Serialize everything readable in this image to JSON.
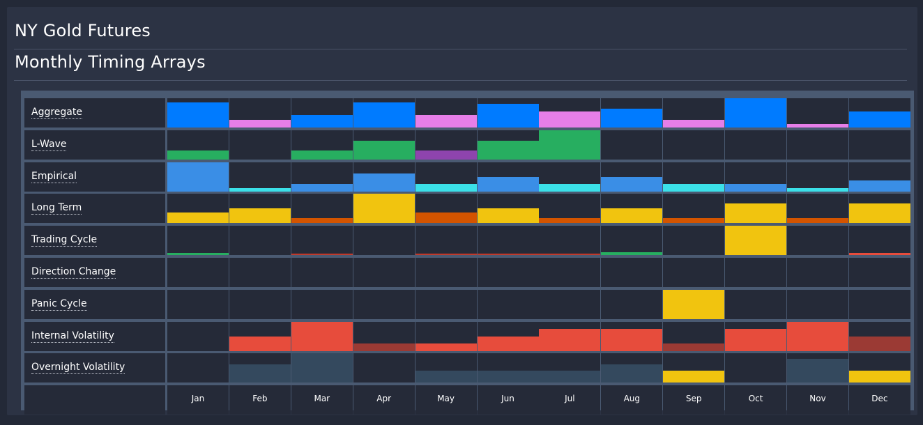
{
  "page": {
    "title": "NY Gold Futures",
    "subtitle": "Monthly Timing Arrays"
  },
  "chart_data": {
    "type": "heatmap",
    "title": "Monthly Timing Arrays",
    "categories": [
      "Jan",
      "Feb",
      "Mar",
      "Apr",
      "May",
      "Jun",
      "Jul",
      "Aug",
      "Sep",
      "Oct",
      "Nov",
      "Dec"
    ],
    "value_scale": "relative strength 0-1 (bar fill height within each cell)",
    "series": [
      {
        "name": "Aggregate",
        "values": [
          0.85,
          0.25,
          0.42,
          0.85,
          0.42,
          0.8,
          0.55,
          0.65,
          0.25,
          1.0,
          0.13,
          0.55
        ],
        "colors": [
          "#007bff",
          "#e67ee8",
          "#007bff",
          "#007bff",
          "#e67ee8",
          "#007bff",
          "#e67ee8",
          "#007bff",
          "#e67ee8",
          "#007bff",
          "#e67ee8",
          "#007bff"
        ]
      },
      {
        "name": "L-Wave",
        "values": [
          0.32,
          0,
          0.32,
          0.65,
          0.32,
          0.65,
          1.0,
          0,
          0,
          0,
          0,
          0
        ],
        "colors": [
          "#27ae60",
          "#27ae60",
          "#27ae60",
          "#27ae60",
          "#8e44ad",
          "#27ae60",
          "#27ae60",
          "#27ae60",
          "#27ae60",
          "#27ae60",
          "#27ae60",
          "#27ae60"
        ]
      },
      {
        "name": "Empirical",
        "values": [
          1.0,
          0.12,
          0.25,
          0.62,
          0.25,
          0.5,
          0.25,
          0.5,
          0.25,
          0.25,
          0.12,
          0.37
        ],
        "colors": [
          "#3a8ee6",
          "#3be0e8",
          "#3a8ee6",
          "#3a8ee6",
          "#3be0e8",
          "#3a8ee6",
          "#3be0e8",
          "#3a8ee6",
          "#3be0e8",
          "#3a8ee6",
          "#3be0e8",
          "#3a8ee6"
        ]
      },
      {
        "name": "Long Term",
        "values": [
          0.35,
          0.5,
          0.17,
          1.0,
          0.35,
          0.5,
          0.17,
          0.5,
          0.17,
          0.67,
          0.17,
          0.67
        ],
        "colors": [
          "#f1c40f",
          "#f1c40f",
          "#d35400",
          "#f1c40f",
          "#d35400",
          "#f1c40f",
          "#d35400",
          "#f1c40f",
          "#d35400",
          "#f1c40f",
          "#d35400",
          "#f1c40f"
        ]
      },
      {
        "name": "Trading Cycle",
        "values": [
          0.08,
          0,
          0.05,
          0,
          0.05,
          0.05,
          0.05,
          0.1,
          0,
          1.0,
          0,
          0.08
        ],
        "colors": [
          "#27ae60",
          "#27ae60",
          "#c0392b",
          "#c0392b",
          "#c0392b",
          "#c0392b",
          "#c0392b",
          "#27ae60",
          "#c0392b",
          "#f1c40f",
          "#c0392b",
          "#e74c3c"
        ]
      },
      {
        "name": "Direction Change",
        "values": [
          0,
          0,
          0,
          0,
          0,
          0,
          0,
          0,
          0,
          0,
          0,
          0
        ],
        "colors": [
          "#f1c40f",
          "#f1c40f",
          "#f1c40f",
          "#f1c40f",
          "#f1c40f",
          "#f1c40f",
          "#f1c40f",
          "#f1c40f",
          "#f1c40f",
          "#f1c40f",
          "#f1c40f",
          "#f1c40f"
        ]
      },
      {
        "name": "Panic Cycle",
        "values": [
          0,
          0,
          0,
          0,
          0,
          0,
          0,
          0,
          1.0,
          0,
          0,
          0
        ],
        "colors": [
          "#f1c40f",
          "#f1c40f",
          "#f1c40f",
          "#f1c40f",
          "#f1c40f",
          "#f1c40f",
          "#f1c40f",
          "#f1c40f",
          "#f1c40f",
          "#f1c40f",
          "#f1c40f",
          "#f1c40f"
        ]
      },
      {
        "name": "Internal Volatility",
        "values": [
          0,
          0.5,
          1.0,
          0.25,
          0.25,
          0.5,
          0.75,
          0.75,
          0.25,
          0.75,
          1.0,
          0.5
        ],
        "colors": [
          "#e74c3c",
          "#e74c3c",
          "#e74c3c",
          "#9b3a34",
          "#e74c3c",
          "#e74c3c",
          "#e74c3c",
          "#e74c3c",
          "#9b3a34",
          "#e74c3c",
          "#e74c3c",
          "#9b3a34"
        ]
      },
      {
        "name": "Overnight Volatility",
        "values": [
          0,
          0.62,
          1.0,
          0,
          0.4,
          0.4,
          0.4,
          0.62,
          0.4,
          0,
          0.82,
          0.4
        ],
        "colors": [
          "#34495e",
          "#34495e",
          "#34495e",
          "#34495e",
          "#34495e",
          "#34495e",
          "#34495e",
          "#34495e",
          "#f1c40f",
          "#34495e",
          "#34495e",
          "#f1c40f"
        ]
      }
    ]
  }
}
